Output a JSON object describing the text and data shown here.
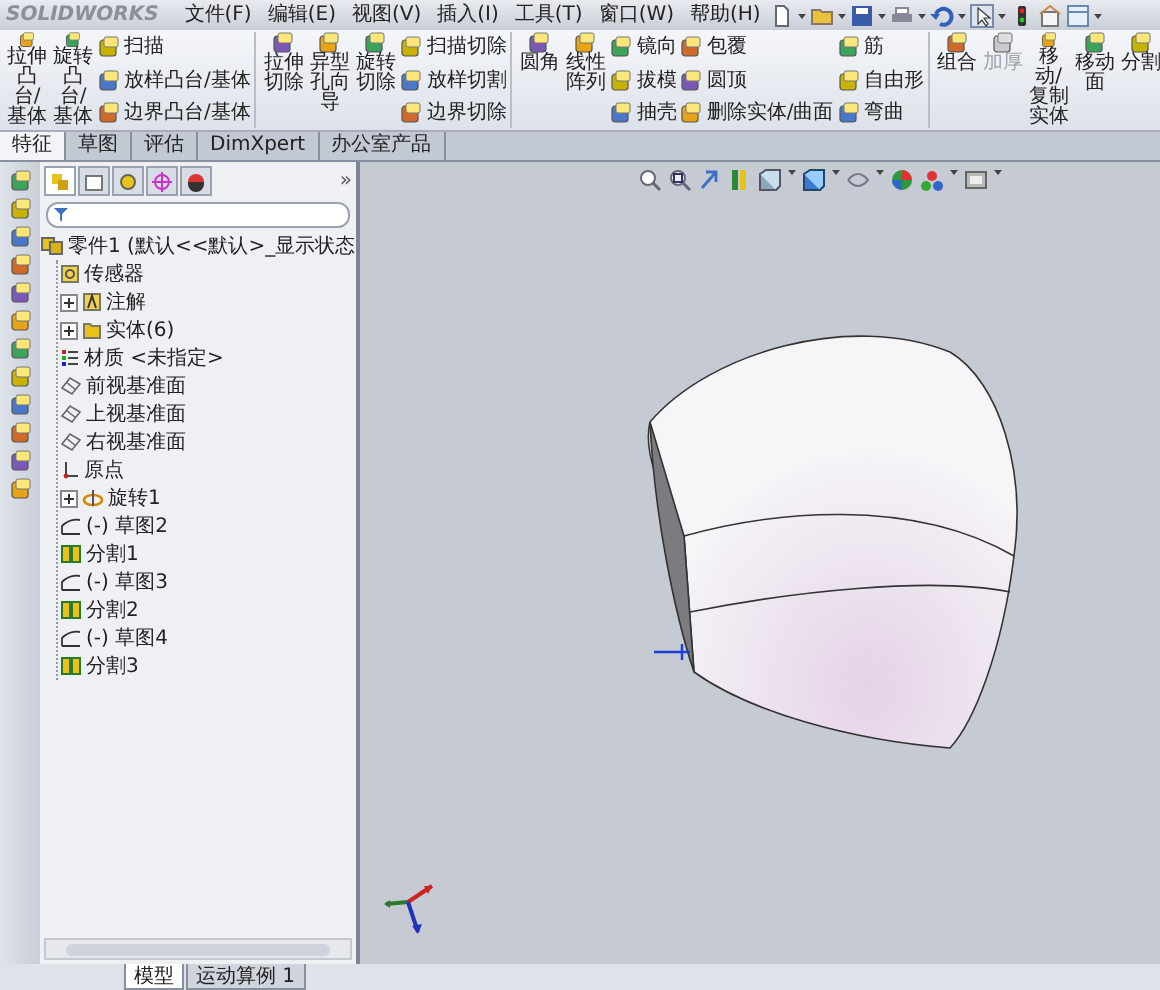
{
  "app": {
    "logo": "SOLIDWORKS"
  },
  "menu": [
    "文件(F)",
    "编辑(E)",
    "视图(V)",
    "插入(I)",
    "工具(T)",
    "窗口(W)",
    "帮助(H)"
  ],
  "ribbon": [
    {
      "items": [
        {
          "kind": "large",
          "label": "拉伸凸台/基体",
          "disabled": false
        },
        {
          "kind": "large",
          "label": "旋转凸台/基体",
          "disabled": false
        },
        {
          "kind": "stack",
          "entries": [
            {
              "label": "扫描",
              "disabled": false
            },
            {
              "label": "放样凸台/基体",
              "disabled": false
            },
            {
              "label": "边界凸台/基体",
              "disabled": false
            }
          ]
        }
      ]
    },
    {
      "items": [
        {
          "kind": "large",
          "label": "拉伸切除",
          "disabled": false
        },
        {
          "kind": "large",
          "label": "异型孔向导",
          "disabled": false
        },
        {
          "kind": "large",
          "label": "旋转切除",
          "disabled": false
        },
        {
          "kind": "stack",
          "entries": [
            {
              "label": "扫描切除",
              "disabled": false
            },
            {
              "label": "放样切割",
              "disabled": false
            },
            {
              "label": "边界切除",
              "disabled": false
            }
          ]
        }
      ]
    },
    {
      "items": [
        {
          "kind": "large",
          "label": "圆角",
          "disabled": false
        },
        {
          "kind": "large",
          "label": "线性阵列",
          "disabled": false
        },
        {
          "kind": "stack",
          "entries": [
            {
              "label": "镜向",
              "disabled": false
            },
            {
              "label": "拔模",
              "disabled": false
            },
            {
              "label": "抽壳",
              "disabled": false
            }
          ]
        },
        {
          "kind": "stack",
          "entries": [
            {
              "label": "包覆",
              "disabled": false
            },
            {
              "label": "圆顶",
              "disabled": false
            },
            {
              "label": "删除实体/曲面",
              "disabled": false
            }
          ]
        },
        {
          "kind": "stack",
          "entries": [
            {
              "label": "筋",
              "disabled": false
            },
            {
              "label": "自由形",
              "disabled": false
            },
            {
              "label": "弯曲",
              "disabled": false
            }
          ]
        }
      ]
    },
    {
      "items": [
        {
          "kind": "large",
          "label": "组合",
          "disabled": false
        },
        {
          "kind": "large",
          "label": "加厚",
          "disabled": true
        },
        {
          "kind": "large",
          "label": "移动/复制实体",
          "disabled": false
        },
        {
          "kind": "large",
          "label": "移动面",
          "disabled": false
        },
        {
          "kind": "large",
          "label": "分割",
          "disabled": false
        }
      ]
    }
  ],
  "tabs": [
    {
      "label": "特征",
      "selected": true
    },
    {
      "label": "草图",
      "selected": false
    },
    {
      "label": "评估",
      "selected": false
    },
    {
      "label": "DimXpert",
      "selected": false
    },
    {
      "label": "办公室产品",
      "selected": false
    }
  ],
  "tree": {
    "collapse": "»",
    "root": {
      "kind": "part",
      "label": "零件1 (默认<<默认>_显示状态",
      "children": [
        {
          "kind": "sensor",
          "label": "传感器"
        },
        {
          "kind": "annotation",
          "label": "注解",
          "expanded": false
        },
        {
          "kind": "solid",
          "label": "实体(6)",
          "expanded": false
        },
        {
          "kind": "material",
          "label": "材质 <未指定>"
        },
        {
          "kind": "plane",
          "label": "前视基准面"
        },
        {
          "kind": "plane",
          "label": "上视基准面"
        },
        {
          "kind": "plane",
          "label": "右视基准面"
        },
        {
          "kind": "origin",
          "label": "原点"
        },
        {
          "kind": "revolve",
          "label": "旋转1",
          "expanded": false
        },
        {
          "kind": "sketch",
          "label": "(-) 草图2"
        },
        {
          "kind": "split",
          "label": "分割1"
        },
        {
          "kind": "sketch",
          "label": "(-) 草图3"
        },
        {
          "kind": "split",
          "label": "分割2"
        },
        {
          "kind": "sketch",
          "label": "(-) 草图4"
        },
        {
          "kind": "split",
          "label": "分割3"
        }
      ]
    }
  },
  "bottom_tabs": [
    {
      "label": "模型",
      "selected": true
    },
    {
      "label": "运动算例 1",
      "selected": false
    }
  ]
}
